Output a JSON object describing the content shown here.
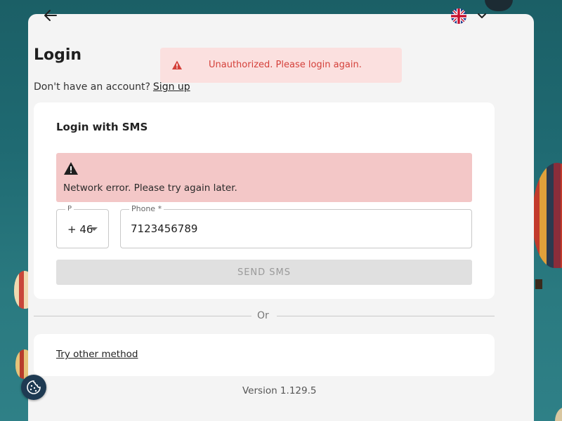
{
  "header": {
    "back_icon": "arrow-left-icon",
    "language_flag": "uk-flag-icon",
    "language_chevron": "chevron-down-icon"
  },
  "page": {
    "title": "Login",
    "signup_prompt": "Don't have an account?",
    "signup_link": "Sign up"
  },
  "toast": {
    "message": "Unauthorized. Please login again.",
    "icon": "warning-icon",
    "color": "#d4403a"
  },
  "sms": {
    "title": "Login with SMS",
    "error_message": "Network error. Please try again later.",
    "error_icon": "warning-icon",
    "prefix_label": "P",
    "prefix_value": "+ 46",
    "phone_label": "Phone *",
    "phone_value": "7123456789",
    "send_button": "SEND SMS"
  },
  "divider": {
    "label": "Or"
  },
  "other": {
    "link": "Try other method"
  },
  "footer": {
    "version": "Version 1.129.5"
  },
  "cookie": {
    "icon": "cookie-icon"
  }
}
